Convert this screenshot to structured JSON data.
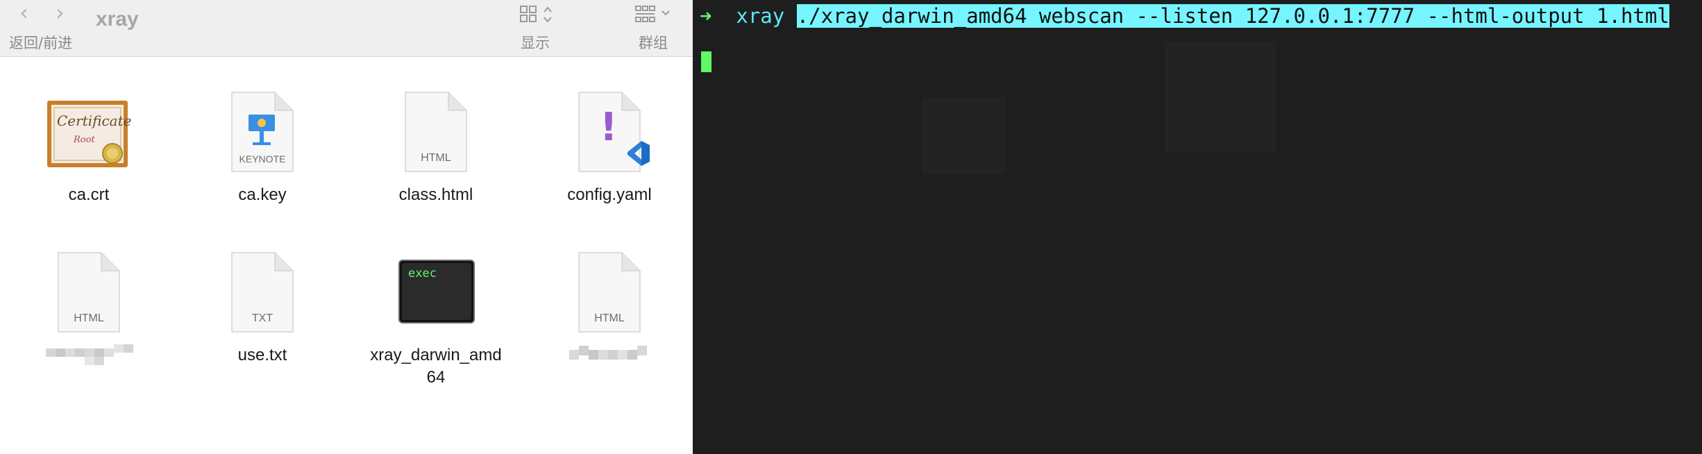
{
  "finder": {
    "nav": {
      "back_glyph": "‹",
      "forward_glyph": "›",
      "label": "返回/前进"
    },
    "title": "xray",
    "view_label": "显示",
    "group_label": "群组",
    "files": [
      {
        "name": "ca.crt",
        "kind": "certificate",
        "icon_text": "Certificate",
        "icon_subtext": "Root"
      },
      {
        "name": "ca.key",
        "kind": "keynote",
        "ext": "KEYNOTE"
      },
      {
        "name": "class.html",
        "kind": "doc",
        "ext": "HTML"
      },
      {
        "name": "config.yaml",
        "kind": "yaml",
        "badge": "!"
      },
      {
        "name": "",
        "kind": "doc",
        "ext": "HTML",
        "blurred": true
      },
      {
        "name": "use.txt",
        "kind": "doc",
        "ext": "TXT"
      },
      {
        "name": "xray_darwin_amd\n64",
        "kind": "exec",
        "icon_text": "exec"
      },
      {
        "name": "",
        "kind": "doc",
        "ext": "HTML",
        "blurred": true
      }
    ]
  },
  "terminal": {
    "prompt_arrow": "➜",
    "prompt_dir": "xray",
    "command": "./xray_darwin_amd64 webscan --listen 127.0.0.1:7777 --html-output 1.html",
    "colors": {
      "background": "#1e1e1e",
      "arrow": "#5ff967",
      "dir": "#5ce7f3",
      "selection": "#76f4ff",
      "cursor": "#5ff967"
    }
  }
}
